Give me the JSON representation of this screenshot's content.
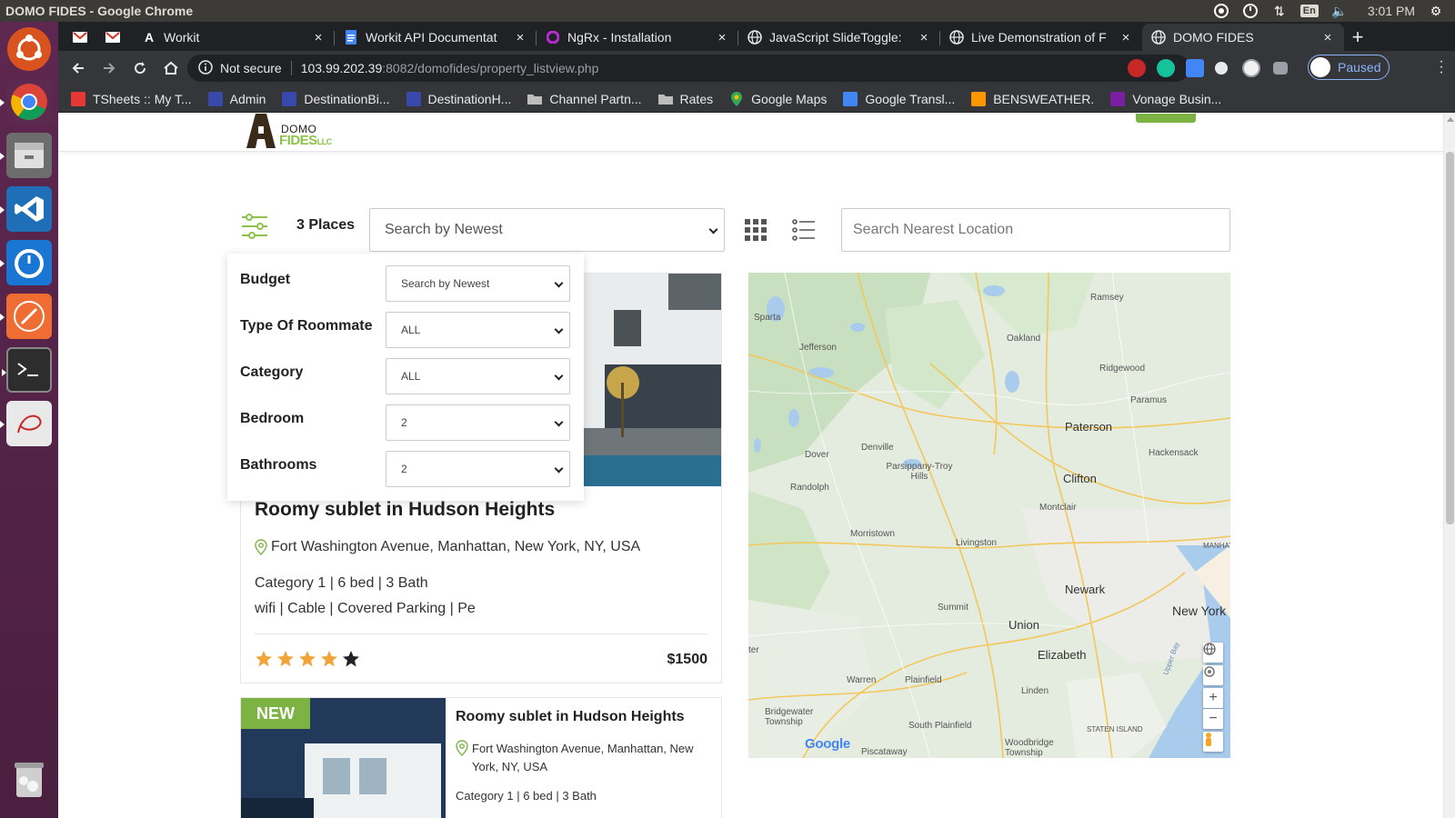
{
  "os": {
    "window_title": "DOMO FIDES - Google Chrome",
    "clock": "3:01 PM",
    "keyboard_lang": "En"
  },
  "browser": {
    "tabs": [
      {
        "label": "",
        "icon": "gmail-icon",
        "pinned": true
      },
      {
        "label": "",
        "icon": "gmail-icon",
        "pinned": true
      },
      {
        "label": "Workit",
        "icon": "angular-icon"
      },
      {
        "label": "Workit API Documentat",
        "icon": "docs-icon"
      },
      {
        "label": "NgRx - Installation",
        "icon": "ngrx-icon"
      },
      {
        "label": "JavaScript SlideToggle:",
        "icon": "globe-icon"
      },
      {
        "label": "Live Demonstration of F",
        "icon": "globe-icon"
      },
      {
        "label": "DOMO FIDES",
        "icon": "globe-icon",
        "active": true
      }
    ],
    "address": {
      "security": "Not secure",
      "host": "103.99.202.39",
      "path": ":8082/domofides/property_listview.php"
    },
    "profile_status": "Paused",
    "bookmarks": [
      {
        "label": "TSheets :: My T...",
        "icon": "tsheets-icon",
        "color": "#e53935"
      },
      {
        "label": "Admin",
        "icon": "admin-icon",
        "color": "#3949ab"
      },
      {
        "label": "DestinationBi...",
        "icon": "destination-icon",
        "color": "#3949ab"
      },
      {
        "label": "DestinationH...",
        "icon": "destination-icon",
        "color": "#3949ab"
      },
      {
        "label": "Channel Partn...",
        "icon": "folder-icon",
        "color": "#bdbdbd"
      },
      {
        "label": "Rates",
        "icon": "folder-icon",
        "color": "#bdbdbd"
      },
      {
        "label": "Google Maps",
        "icon": "maps-icon",
        "color": "#34a853"
      },
      {
        "label": "Google Transl...",
        "icon": "translate-icon",
        "color": "#4285f4"
      },
      {
        "label": "BENSWEATHER.",
        "icon": "weather-icon",
        "color": "#ff9800"
      },
      {
        "label": "Vonage Busin...",
        "icon": "vonage-icon",
        "color": "#7b1fa2"
      }
    ]
  },
  "site": {
    "logo": {
      "line1": "DOMO",
      "line2": "FIDES",
      "suffix": "LLC"
    },
    "places_count": "3 Places",
    "sort": {
      "selected": "Search by Newest"
    },
    "location_search": {
      "placeholder": "Search Nearest Location",
      "value": ""
    },
    "filters": [
      {
        "label": "Budget",
        "value": "Search by Newest"
      },
      {
        "label": "Type Of Roommate",
        "value": "ALL"
      },
      {
        "label": "Category",
        "value": "ALL"
      },
      {
        "label": "Bedroom",
        "value": "2"
      },
      {
        "label": "Bathrooms",
        "value": "2"
      }
    ],
    "listings": [
      {
        "title": "Roomy sublet in Hudson Heights",
        "address": "Fort Washington Avenue, Manhattan, New York, NY, USA",
        "meta": "Category 1 | 6 bed | 3 Bath",
        "amenities": "wifi | Cable | Covered Parking | Pe",
        "rating": 4,
        "rating_max": 5,
        "price": "$1500"
      },
      {
        "badge": "NEW",
        "title": "Roomy sublet in Hudson Heights",
        "address": "Fort Washington Avenue, Manhattan, New York, NY, USA",
        "meta": "Category 1 | 6 bed | 3 Bath"
      }
    ],
    "map": {
      "places": [
        "Sparta",
        "Jefferson",
        "Ramsey",
        "Oakland",
        "Ridgewood",
        "Paramus",
        "Paterson",
        "Hackensack",
        "Denville",
        "Dover",
        "Parsippany-Troy Hills",
        "Clifton",
        "Randolph",
        "Montclair",
        "Morristown",
        "Livingston",
        "Newark",
        "New York",
        "Summit",
        "Union",
        "Elizabeth",
        "Warren",
        "Plainfield",
        "Linden",
        "Bridgewater Township",
        "South Plainfield",
        "Woodbridge Township",
        "Piscataway",
        "STATEN ISLAND",
        "MANHAT",
        "Upper Bay",
        "ter"
      ],
      "attribution": "Google"
    }
  },
  "colors": {
    "accent_green": "#7cb342",
    "star_orange": "#f2a33a",
    "chrome_dark": "#35363a"
  }
}
